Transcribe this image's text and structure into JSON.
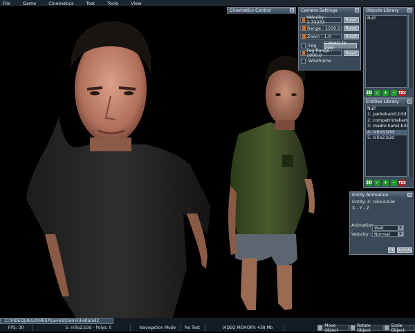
{
  "menu": [
    "File",
    "Game",
    "Cinematics",
    "Test",
    "Tools",
    "View"
  ],
  "cinematics_panel": {
    "title": "Cinematics Control"
  },
  "camera_settings": {
    "title": "Camera Settings",
    "velocity": "Velocity : 1.73333",
    "range": "Range : 1500.0",
    "zoom": "Zoom : 1.0",
    "reset": "Reset",
    "fog_label": "Fog",
    "camera_to_zero": "Camera to Zero",
    "fog_range": "Fog Range : 1000.0",
    "wireframe_label": "Wireframe",
    "colors": {
      "velocity": "#e06a1c",
      "range": "#e06a1c",
      "zoom": "#e06a1c",
      "fog_range": "#e06a1c"
    }
  },
  "objects_library": {
    "title": "Objects Library",
    "items": [
      "Null"
    ]
  },
  "entities_library": {
    "title": "Entities Library",
    "items": [
      "Null",
      "1: padrekamil.b3d",
      "2: compatriotakami",
      "3: madre kamil.b3d",
      "4: niño3.b3d",
      "5: niño2.b3d"
    ],
    "selected_index": 4
  },
  "library_icons": [
    "3D",
    "check",
    "add",
    "remove",
    "TEX"
  ],
  "entity_animation": {
    "title": "Entity Animation",
    "entity": "Entity: 4: niño3.b3d",
    "coords": "X - Y - Z",
    "animation_label": "Animation :",
    "animation_value": "Wait",
    "velocity_label": "Velocity :",
    "velocity_value": "Normal",
    "ok": "Ok",
    "update": "Update"
  },
  "status": {
    "path": "C:\\VIDEOJUEGO\\MESP\\Levels\\DomicilioKamil2",
    "fps": "FPS: 30",
    "selection": "5: niño2.b3d - Polys: 0",
    "mode": "Navegation Mode",
    "test": "No Test",
    "video_memory": "VIDEO MEMORY: 438 Mb",
    "move": "Move Object",
    "rotate": "Rotate Object",
    "scale": "Scale Object"
  }
}
